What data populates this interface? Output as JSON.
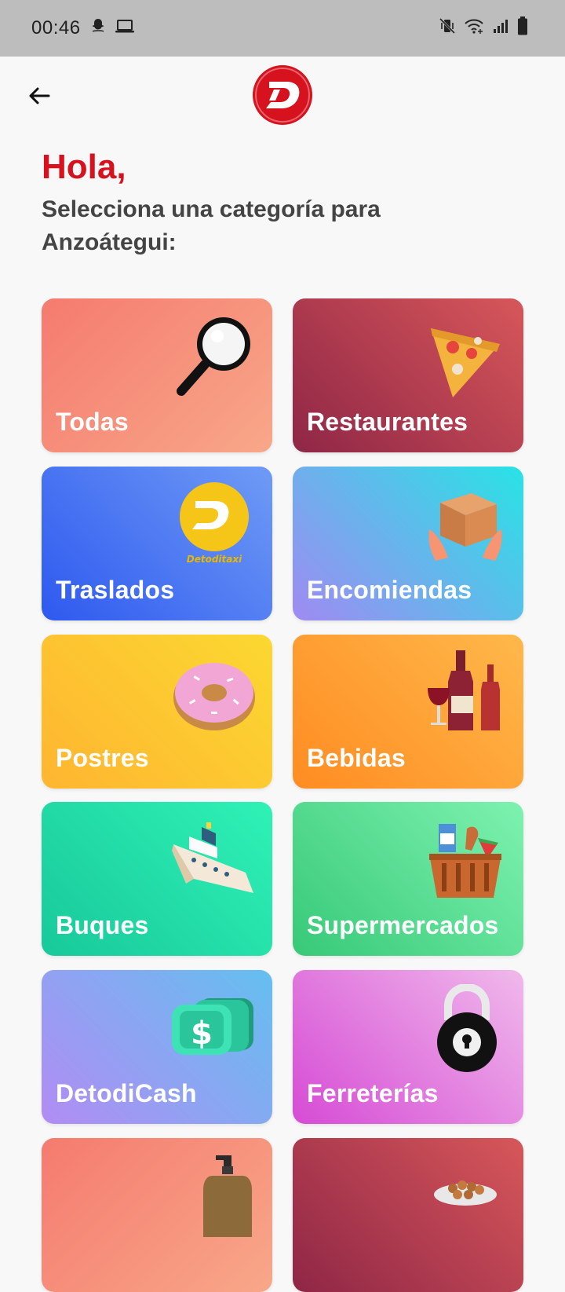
{
  "status_bar": {
    "time": "00:46",
    "left_icons": [
      "snapchat-icon",
      "laptop-icon"
    ],
    "right_icons": [
      "mute-vibrate-icon",
      "wifi-icon",
      "signal-icon",
      "battery-icon"
    ]
  },
  "header": {
    "back_icon": "arrow-left-icon",
    "logo": "detodi-logo",
    "brand_color": "#d7121f"
  },
  "greeting": "Hola,",
  "subtitle": "Selecciona una categoría para Anzoátegui:",
  "categories": [
    {
      "label": "Todas",
      "icon": "magnifier-icon"
    },
    {
      "label": "Restaurantes",
      "icon": "pizza-icon"
    },
    {
      "label": "Traslados",
      "icon": "detoditaxi-logo-icon",
      "icon_text": "Detoditaxi"
    },
    {
      "label": "Encomiendas",
      "icon": "package-hands-icon"
    },
    {
      "label": "Postres",
      "icon": "donut-icon"
    },
    {
      "label": "Bebidas",
      "icon": "wine-bottles-icon"
    },
    {
      "label": "Buques",
      "icon": "ship-icon"
    },
    {
      "label": "Supermercados",
      "icon": "grocery-basket-icon"
    },
    {
      "label": "DetodiCash",
      "icon": "cash-stack-icon"
    },
    {
      "label": "Ferreterías",
      "icon": "padlock-icon"
    },
    {
      "label": "",
      "icon": "soap-bottle-icon"
    },
    {
      "label": "",
      "icon": "pet-food-bowl-icon"
    }
  ]
}
